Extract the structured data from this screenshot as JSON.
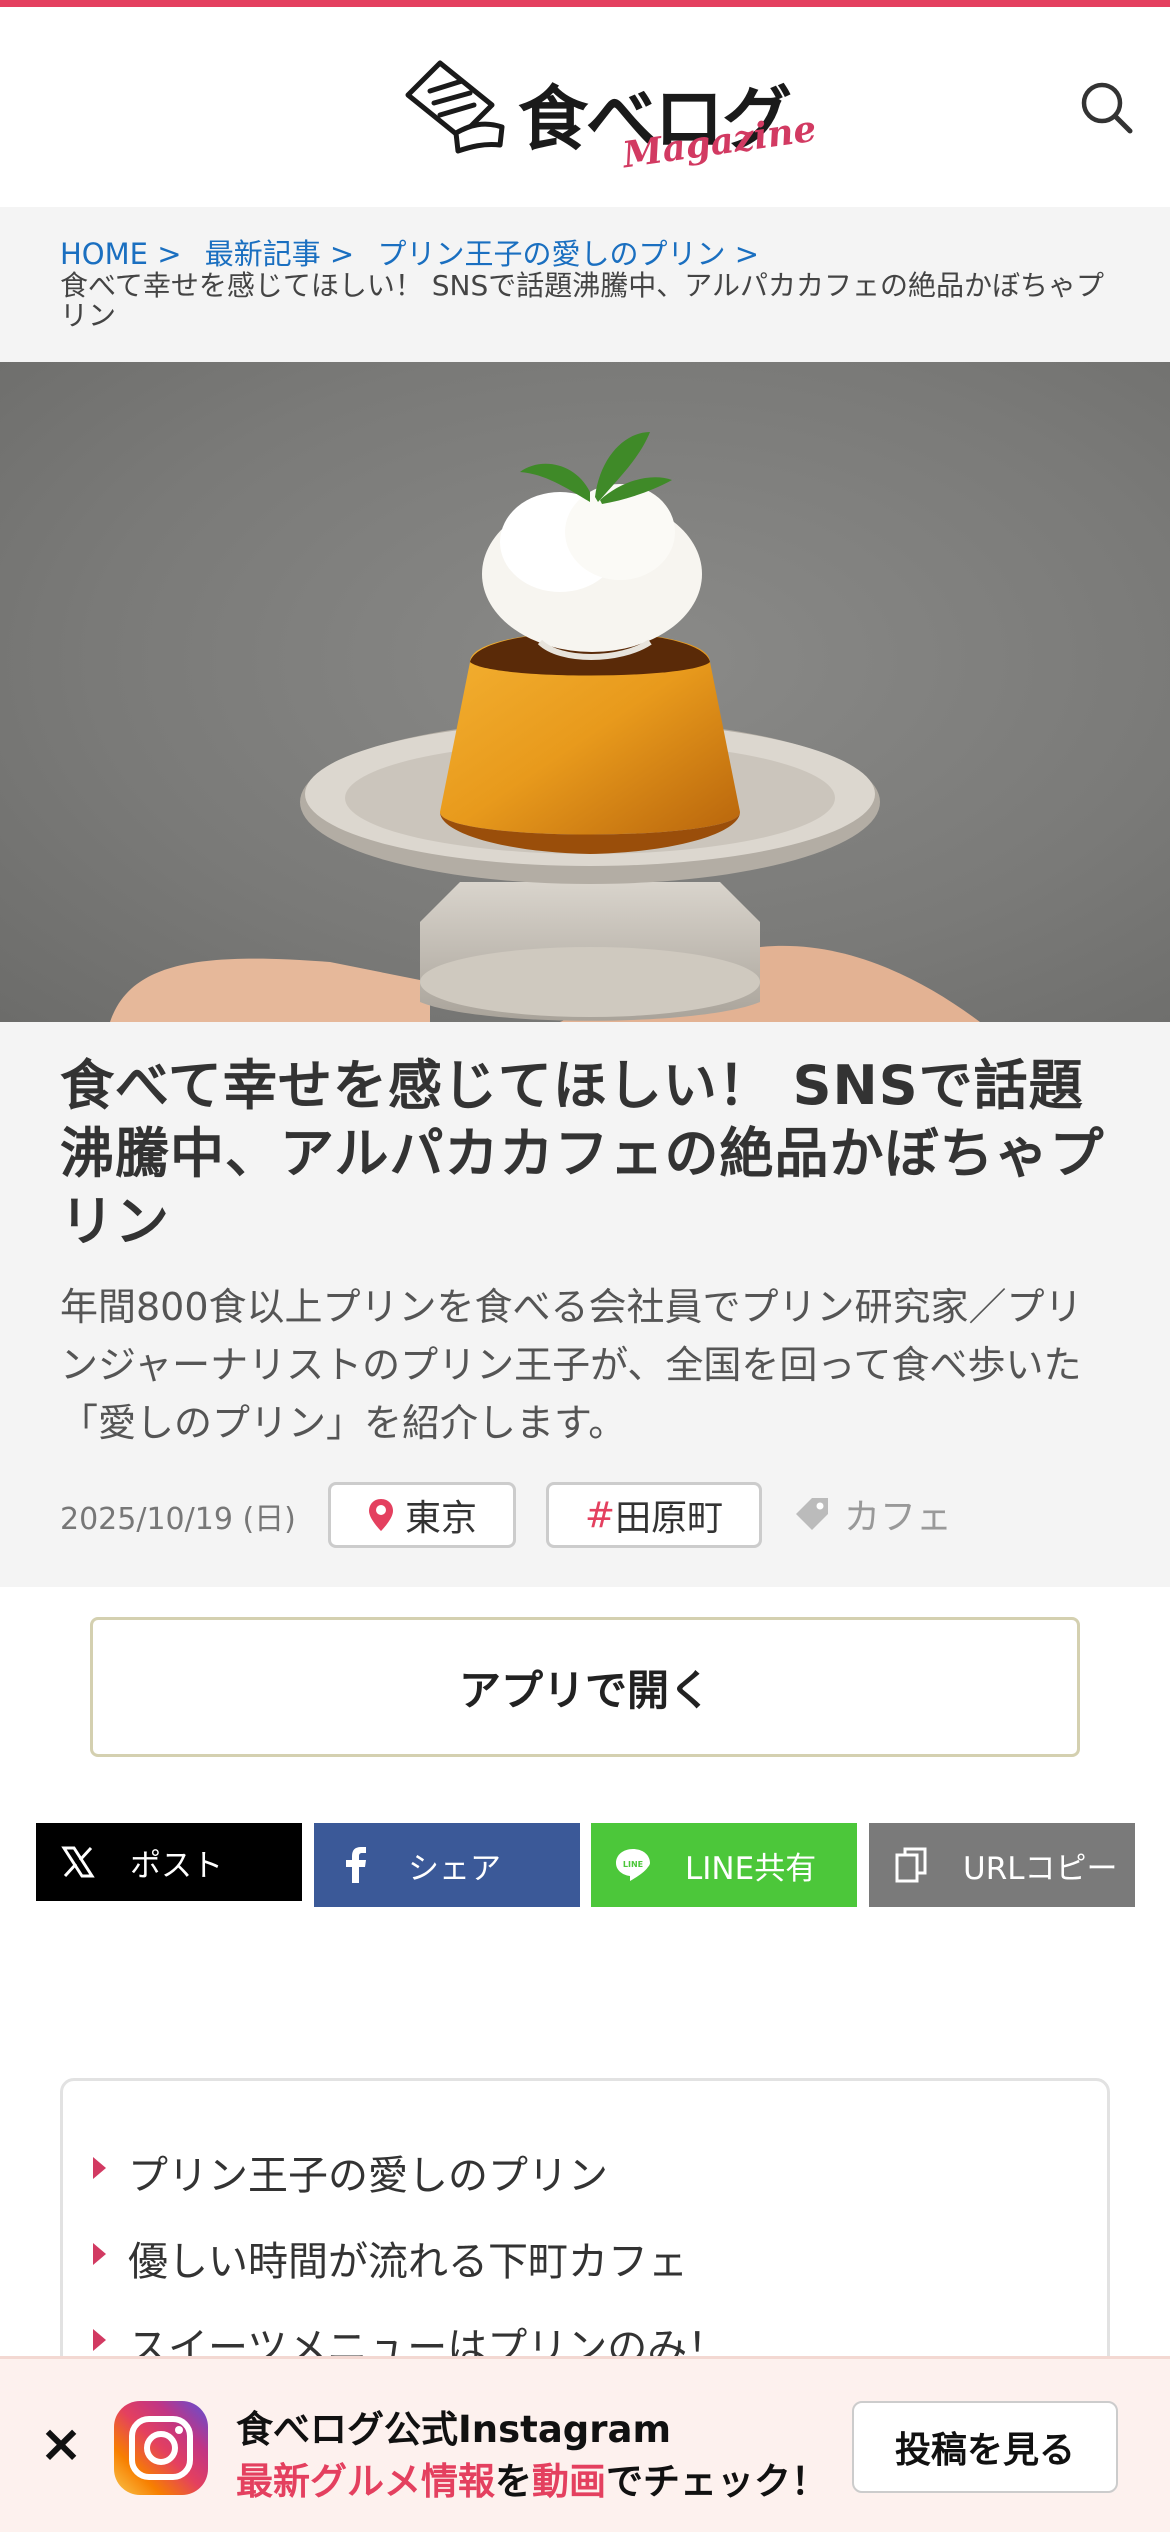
{
  "header": {
    "logo_text": "食べログ",
    "logo_sub": "Magazine"
  },
  "breadcrumb": {
    "items": [
      "HOME >",
      "最新記事 >",
      "プリン王子の愛しのプリン >"
    ],
    "current": "食べて幸せを感じてほしい！ SNSで話題沸騰中、アルパカカフェの絶品かぼちゃプリン"
  },
  "article": {
    "title": "食べて幸せを感じてほしい！ SNSで話題沸騰中、アルパカカフェの絶品かぼちゃプリン",
    "lead": "年間800食以上プリンを食べる会社員でプリン研究家／プリンジャーナリストのプリン王子が、全国を回って食べ歩いた「愛しのプリン」を紹介します。",
    "date": "2025/10/19 (日)",
    "area": "東京",
    "tag_hash": "#",
    "tag": "田原町",
    "category": "カフェ"
  },
  "app_button": "アプリで開く",
  "share": {
    "x": "ポスト",
    "facebook": "シェア",
    "line": "LINE共有",
    "url": "URLコピー"
  },
  "toc": {
    "items": [
      "プリン王子の愛しのプリン",
      "優しい時間が流れる下町カフェ",
      "スイーツメニューはプリンのみ！"
    ]
  },
  "banner": {
    "close": "×",
    "title": "食べログ公式Instagram",
    "sub_red1": "最新グルメ情報",
    "sub_mid": "を",
    "sub_red2": "動画",
    "sub_end": "でチェック！",
    "button": "投稿を見る"
  },
  "colors": {
    "accent": "#e4405f",
    "link": "#1a6fc0",
    "x": "#000000",
    "facebook": "#3b5998",
    "line": "#4cc73a",
    "url": "#7a7a7a"
  }
}
